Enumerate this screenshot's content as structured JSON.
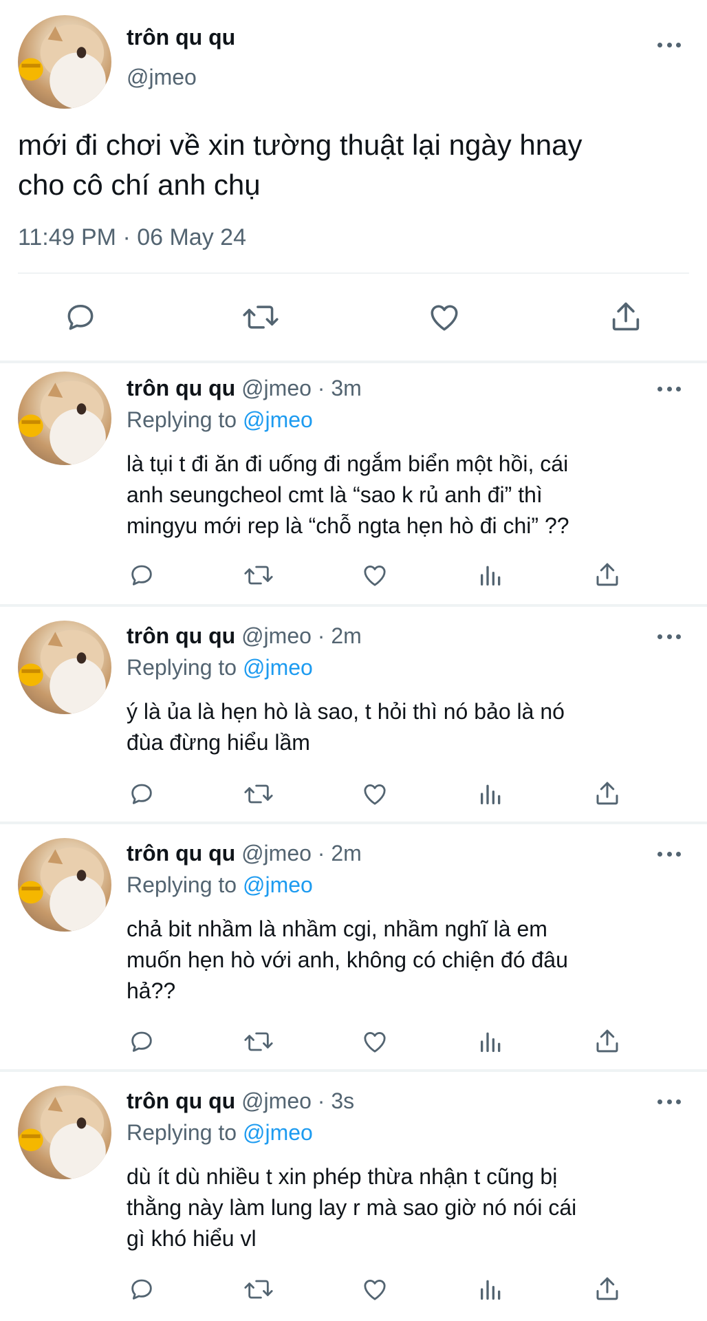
{
  "main_tweet": {
    "display_name": "trôn qu qu",
    "handle": "@jmeo",
    "text_lines": [
      "mới đi chơi về xin tường thuật lại ngày hnay",
      "cho cô chí anh chụ"
    ],
    "timestamp": "11:49 PM · 06 May 24",
    "actions": [
      "reply-icon",
      "retweet-icon",
      "like-icon",
      "share-icon"
    ]
  },
  "replies": [
    {
      "display_name": "trôn qu qu",
      "meta": "@jmeo · 3m",
      "replying_prefix": "Replying to",
      "replying_to": "@jmeo",
      "text_lines": [
        "là tụi t đi ăn đi uống đi ngắm biển một hồi, cái",
        "anh seungcheol cmt là “sao k rủ anh đi” thì",
        "mingyu mới rep là “chỗ ngta hẹn hò đi chi” ??"
      ]
    },
    {
      "display_name": "trôn qu qu",
      "meta": "@jmeo · 2m",
      "replying_prefix": "Replying to",
      "replying_to": "@jmeo",
      "text_lines": [
        "ý là ủa là hẹn hò là sao, t hỏi thì nó bảo là nó",
        "đùa đừng hiểu lầm"
      ]
    },
    {
      "display_name": "trôn qu qu",
      "meta": "@jmeo · 2m",
      "replying_prefix": "Replying to",
      "replying_to": "@jmeo",
      "text_lines": [
        "chả bit nhầm là nhầm cgi, nhầm nghĩ là em",
        "muốn hẹn hò với anh, không có chiện đó đâu",
        "hả??"
      ]
    },
    {
      "display_name": "trôn qu qu",
      "meta": "@jmeo · 3s",
      "replying_prefix": "Replying to",
      "replying_to": "@jmeo",
      "text_lines": [
        "dù ít dù nhiều t xin phép thừa nhận t cũng bị",
        "thằng này làm lung lay r mà sao giờ nó nói cái",
        "gì khó hiểu vl"
      ]
    }
  ],
  "reply_actions": [
    "reply-icon",
    "retweet-icon",
    "like-icon",
    "views-icon",
    "share-icon"
  ],
  "colors": {
    "text": "#0f1419",
    "muted": "#536471",
    "link": "#1d9bf0",
    "divider": "#eff3f4"
  }
}
